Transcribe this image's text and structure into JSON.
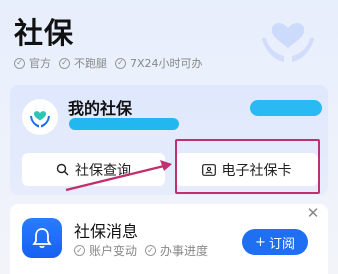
{
  "header": {
    "title": "社保",
    "features": [
      "官方",
      "不跑腿",
      "7X24小时可办"
    ]
  },
  "social_card": {
    "title": "我的社保",
    "buttons": {
      "query": "社保查询",
      "ecard": "电子社保卡"
    }
  },
  "message": {
    "title": "社保消息",
    "tags": [
      "账户变动",
      "办事进度"
    ],
    "subscribe_label": "订阅"
  },
  "colors": {
    "accent": "#1f6ff2",
    "mask": "#23b7f0",
    "highlight": "#c0306e"
  }
}
